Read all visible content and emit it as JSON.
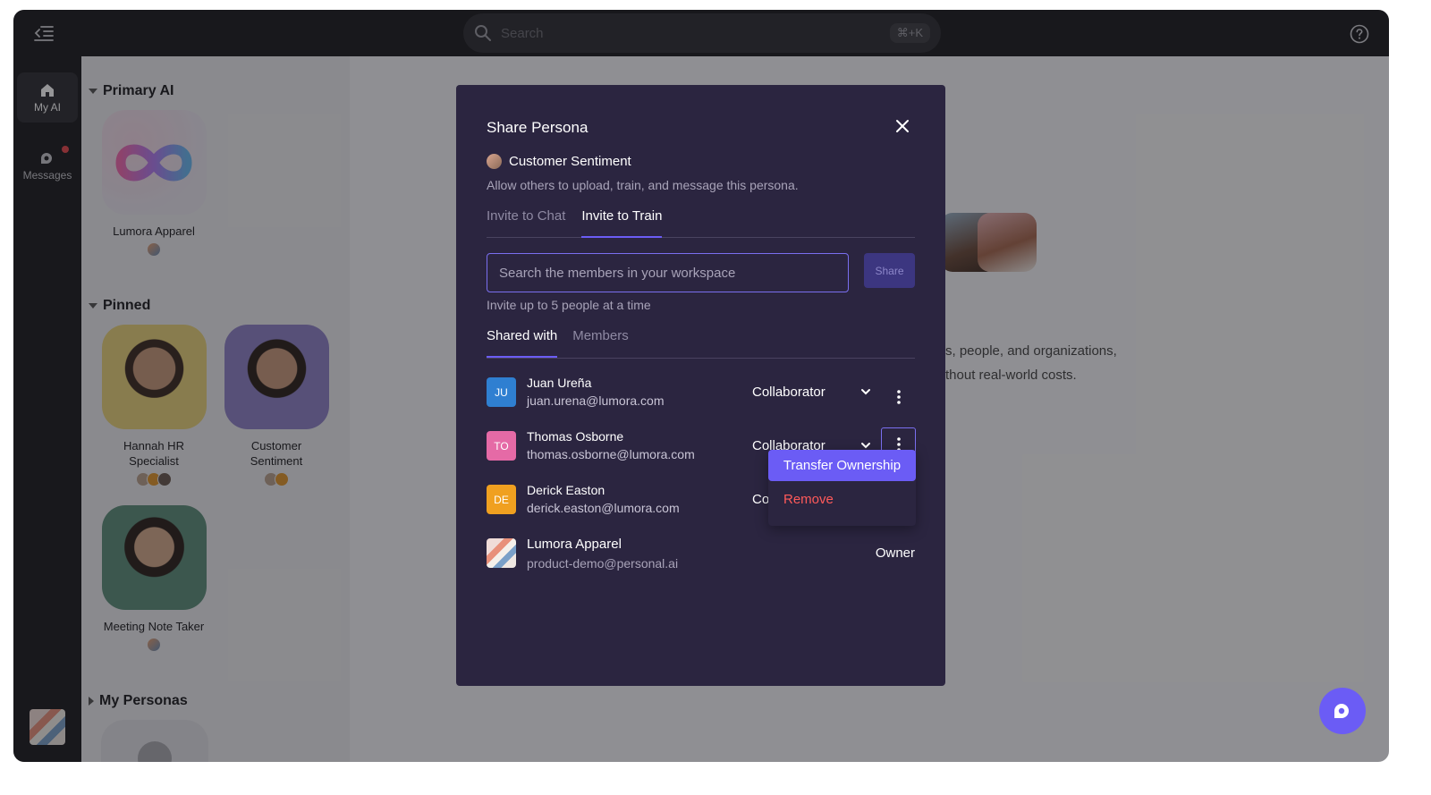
{
  "topbar": {
    "search_placeholder": "Search",
    "shortcut": "⌘+K"
  },
  "rail": {
    "items": [
      {
        "label": "My AI",
        "icon": "home-icon",
        "active": true
      },
      {
        "label": "Messages",
        "icon": "messages-icon",
        "has_notification": true
      }
    ]
  },
  "sidebar": {
    "sections": [
      {
        "title": "Primary AI",
        "expanded": true,
        "personas": [
          {
            "name": "Lumora Apparel"
          }
        ]
      },
      {
        "title": "Pinned",
        "expanded": true,
        "personas": [
          {
            "name": "Hannah HR Specialist"
          },
          {
            "name": "Customer Sentiment"
          },
          {
            "name": "Meeting Note Taker"
          }
        ]
      },
      {
        "title": "My Personas",
        "expanded": false
      }
    ]
  },
  "background": {
    "text_line1": "s, people, and organizations,",
    "text_line2": "thout real-world costs."
  },
  "modal": {
    "title": "Share Persona",
    "persona_name": "Customer Sentiment",
    "description": "Allow others to upload, train, and message this persona.",
    "tabs": [
      "Invite to Chat",
      "Invite to Train"
    ],
    "active_tab": "Invite to Train",
    "search_placeholder": "Search the members in your workspace",
    "share_label": "Share",
    "hint": "Invite up to 5 people at a time",
    "subtabs": [
      "Shared with",
      "Members"
    ],
    "members": [
      {
        "initials": "JU",
        "name": "Juan Ureña",
        "email": "juan.urena@lumora.com",
        "role": "Collaborator",
        "color": "#2f7fd1"
      },
      {
        "initials": "TO",
        "name": "Thomas Osborne",
        "email": "thomas.osborne@lumora.com",
        "role": "Collaborator",
        "color": "#e56aa6"
      },
      {
        "initials": "DE",
        "name": "Derick Easton",
        "email": "derick.easton@lumora.com",
        "role": "Co",
        "color": "#f0a020"
      },
      {
        "name": "Lumora Apparel",
        "email": "product-demo@personal.ai",
        "role": "Owner"
      }
    ],
    "menu": {
      "transfer": "Transfer Ownership",
      "remove": "Remove"
    }
  },
  "colors": {
    "accent": "#6b5cf5",
    "modal_bg": "#2b2540",
    "danger": "#ff5a5a"
  }
}
